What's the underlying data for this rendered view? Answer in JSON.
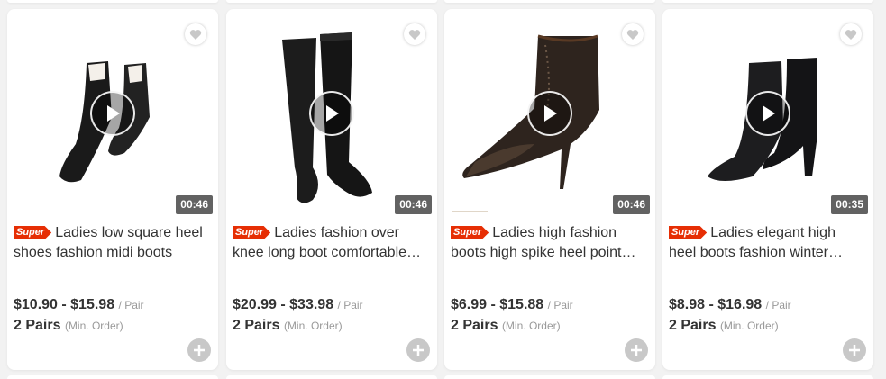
{
  "products": [
    {
      "badge": "Super",
      "title": "Ladies low square heel shoes fashion midi boots",
      "price": "$10.90 - $15.98",
      "unit": "/ Pair",
      "moq": "2 Pairs",
      "moq_note": "(Min. Order)",
      "duration": "00:46"
    },
    {
      "badge": "Super",
      "title": "Ladies fashion over knee long boot comfortable low heel boots",
      "price": "$20.99 - $33.98",
      "unit": "/ Pair",
      "moq": "2 Pairs",
      "moq_note": "(Min. Order)",
      "duration": "00:46"
    },
    {
      "badge": "Super",
      "title": "Ladies high fashion boots high spike heel pointed toe",
      "price": "$6.99 - $15.88",
      "unit": "/ Pair",
      "moq": "2 Pairs",
      "moq_note": "(Min. Order)",
      "duration": "00:46"
    },
    {
      "badge": "Super",
      "title": "Ladies elegant high heel boots fashion winter shoes for women",
      "price": "$8.98 - $16.98",
      "unit": "/ Pair",
      "moq": "2 Pairs",
      "moq_note": "(Min. Order)",
      "duration": "00:35"
    }
  ],
  "colors": {
    "badge": "#e62e04",
    "text": "#333333",
    "muted": "#999999",
    "background": "#f2f2f2"
  },
  "icons": {
    "favorite": "heart-icon",
    "play": "play-icon",
    "add": "plus-icon"
  }
}
